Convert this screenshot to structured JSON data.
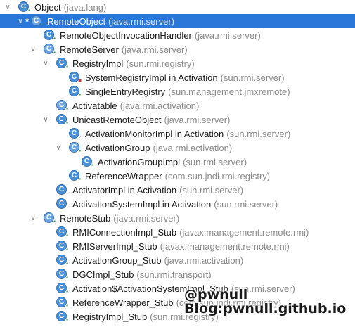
{
  "rows": [
    {
      "name": "Object",
      "pkg": "(java.lang)",
      "lvl": 0,
      "arrow": "down",
      "icon": "class-icon",
      "badge": "unlock"
    },
    {
      "name": "RemoteObject",
      "pkg": "(java.rmi.server)",
      "lvl": 1,
      "arrow": "down",
      "star": "*",
      "icon": "abstract-class-icon",
      "badge": "unlock",
      "selected": true
    },
    {
      "name": "RemoteObjectInvocationHandler",
      "pkg": "(java.rmi.server)",
      "lvl": 2,
      "arrow": "",
      "icon": "class-icon",
      "badge": "unlock"
    },
    {
      "name": "RemoteServer",
      "pkg": "(java.rmi.server)",
      "lvl": 2,
      "arrow": "down",
      "icon": "abstract-class-icon",
      "badge": "unlock"
    },
    {
      "name": "RegistryImpl",
      "pkg": "(sun.rmi.registry)",
      "lvl": 3,
      "arrow": "down",
      "icon": "class-icon",
      "badge": "unlock"
    },
    {
      "name": "SystemRegistryImpl in Activation",
      "pkg": "(sun.rmi.server)",
      "lvl": 4,
      "arrow": "",
      "icon": "class-icon",
      "badge": "lock"
    },
    {
      "name": "SingleEntryRegistry",
      "pkg": "(sun.management.jmxremote)",
      "lvl": 4,
      "arrow": "",
      "icon": "class-icon",
      "badge": "unlock"
    },
    {
      "name": "Activatable",
      "pkg": "(java.rmi.activation)",
      "lvl": 3,
      "arrow": "",
      "icon": "abstract-class-icon",
      "badge": "unlock"
    },
    {
      "name": "UnicastRemoteObject",
      "pkg": "(java.rmi.server)",
      "lvl": 3,
      "arrow": "down",
      "icon": "class-icon",
      "badge": "unlock"
    },
    {
      "name": "ActivationMonitorImpl in Activation",
      "pkg": "(sun.rmi.server)",
      "lvl": 4,
      "arrow": "",
      "icon": "class-icon",
      "badge": "dot"
    },
    {
      "name": "ActivationGroup",
      "pkg": "(java.rmi.activation)",
      "lvl": 4,
      "arrow": "down",
      "icon": "abstract-class-icon",
      "badge": "unlock"
    },
    {
      "name": "ActivationGroupImpl",
      "pkg": "(sun.rmi.server)",
      "lvl": 5,
      "arrow": "",
      "icon": "class-icon",
      "badge": "unlock"
    },
    {
      "name": "ReferenceWrapper",
      "pkg": "(com.sun.jndi.rmi.registry)",
      "lvl": 4,
      "arrow": "",
      "icon": "class-icon",
      "badge": "unlock"
    },
    {
      "name": "ActivatorImpl in Activation",
      "pkg": "(sun.rmi.server)",
      "lvl": 3,
      "arrow": "",
      "icon": "class-icon",
      "badge": "dot"
    },
    {
      "name": "ActivationSystemImpl in Activation",
      "pkg": "(sun.rmi.server)",
      "lvl": 3,
      "arrow": "",
      "icon": "class-icon",
      "badge": "dot"
    },
    {
      "name": "RemoteStub",
      "pkg": "(java.rmi.server)",
      "lvl": 2,
      "arrow": "down",
      "icon": "abstract-class-icon",
      "badge": "unlock"
    },
    {
      "name": "RMIConnectionImpl_Stub",
      "pkg": "(javax.management.remote.rmi)",
      "lvl": 3,
      "arrow": "",
      "icon": "class-icon",
      "badge": "unlock"
    },
    {
      "name": "RMIServerImpl_Stub",
      "pkg": "(javax.management.remote.rmi)",
      "lvl": 3,
      "arrow": "",
      "icon": "class-icon",
      "badge": "unlock"
    },
    {
      "name": "ActivationGroup_Stub",
      "pkg": "(java.rmi.activation)",
      "lvl": 3,
      "arrow": "",
      "icon": "class-icon",
      "badge": "unlock"
    },
    {
      "name": "DGCImpl_Stub",
      "pkg": "(sun.rmi.transport)",
      "lvl": 3,
      "arrow": "",
      "icon": "class-icon",
      "badge": "unlock"
    },
    {
      "name": "Activation$ActivationSystemImpl_Stub",
      "pkg": "(sun.rmi.server)",
      "lvl": 3,
      "arrow": "",
      "icon": "class-icon",
      "badge": "unlock"
    },
    {
      "name": "ReferenceWrapper_Stub",
      "pkg": "(com.sun.jndi.rmi.registry)",
      "lvl": 3,
      "arrow": "",
      "icon": "class-icon",
      "badge": "unlock"
    },
    {
      "name": "RegistryImpl_Stub",
      "pkg": "(sun.rmi.registry)",
      "lvl": 3,
      "arrow": "",
      "icon": "class-icon",
      "badge": "unlock"
    }
  ],
  "icon_letter": "C",
  "watermark": {
    "line1": "@pwnull",
    "line2": "Blog:pwnull.github.io"
  },
  "colors": {
    "selection": "#2b77d9",
    "class_icon": "#4a90d9",
    "package_text": "#8a8a8a"
  }
}
